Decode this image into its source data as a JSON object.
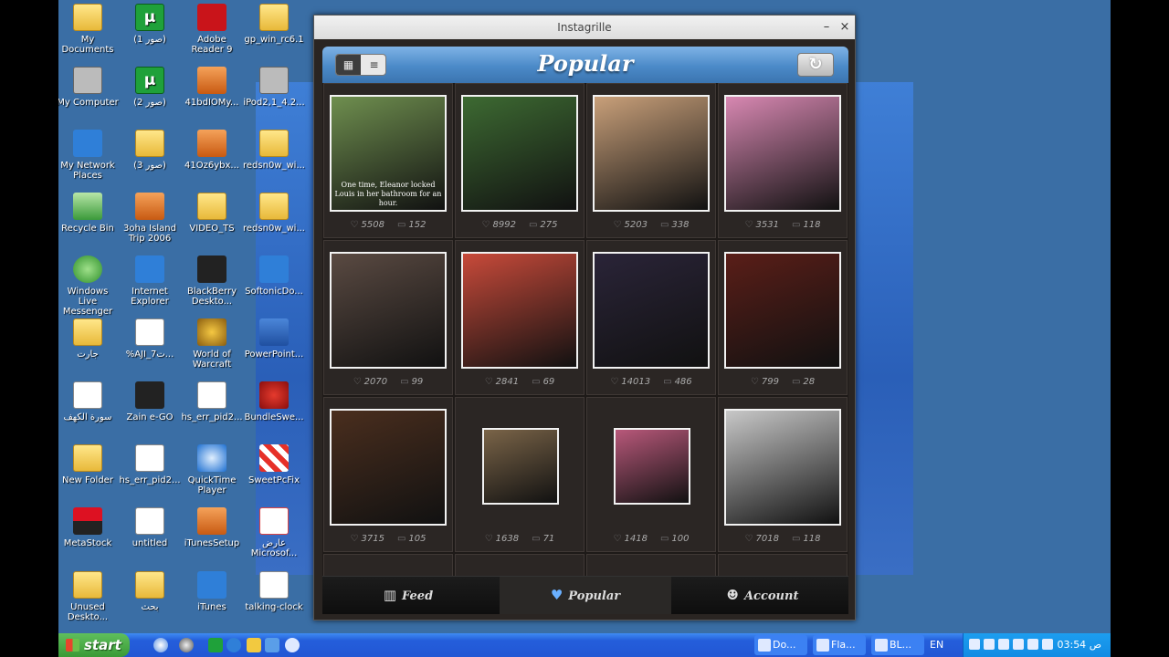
{
  "window": {
    "title": "Instagrille",
    "minimize_glyph": "–",
    "close_glyph": "×"
  },
  "header": {
    "title": "Popular",
    "grid_view_glyph": "▦",
    "list_view_glyph": "≡",
    "refresh_glyph": "↻"
  },
  "photos": [
    {
      "likes": "5508",
      "comments": "152",
      "color": "#6f8f4f"
    },
    {
      "likes": "8992",
      "comments": "275",
      "color": "#3d6a32"
    },
    {
      "likes": "5203",
      "comments": "338",
      "color": "#c9a07a"
    },
    {
      "likes": "3531",
      "comments": "118",
      "color": "#d888b2"
    },
    {
      "likes": "2070",
      "comments": "99",
      "color": "#5a4a42"
    },
    {
      "likes": "2841",
      "comments": "69",
      "color": "#c84a3a"
    },
    {
      "likes": "14013",
      "comments": "486",
      "color": "#2a2438"
    },
    {
      "likes": "799",
      "comments": "28",
      "color": "#5a1e18"
    },
    {
      "likes": "3715",
      "comments": "105",
      "color": "#4a2e1e"
    },
    {
      "likes": "1638",
      "comments": "71",
      "color": "#7a6448"
    },
    {
      "likes": "1418",
      "comments": "100",
      "color": "#b8587a"
    },
    {
      "likes": "7018",
      "comments": "118",
      "color": "#c8c8c8"
    }
  ],
  "photo_caption_1": "One time, Eleanor locked Louis in her bathroom for an hour.",
  "tabs": [
    {
      "label": "Feed",
      "icon": "▥"
    },
    {
      "label": "Popular",
      "icon": "♥"
    },
    {
      "label": "Account",
      "icon": "☻"
    }
  ],
  "desktop_icons": [
    {
      "label": "My Documents"
    },
    {
      "label": "(صور 1)"
    },
    {
      "label": "Adobe Reader 9"
    },
    {
      "label": "gp_win_rc6.1"
    },
    {
      "label": "My Computer"
    },
    {
      "label": "(صور 2)"
    },
    {
      "label": "41bdIOMy..."
    },
    {
      "label": "iPod2,1_4.2..."
    },
    {
      "label": "My Network Places"
    },
    {
      "label": "(صور 3)"
    },
    {
      "label": "41Oz6ybx..."
    },
    {
      "label": "redsn0w_wi..."
    },
    {
      "label": "Recycle Bin"
    },
    {
      "label": "3oha Island Trip 2006"
    },
    {
      "label": "VIDEO_TS"
    },
    {
      "label": "redsn0w_wi..."
    },
    {
      "label": "Windows Live Messenger"
    },
    {
      "label": "Internet Explorer"
    },
    {
      "label": "BlackBerry Deskto..."
    },
    {
      "label": "SoftonicDo..."
    },
    {
      "label": "جارت"
    },
    {
      "label": "%AJI_ت7..."
    },
    {
      "label": "World of Warcraft"
    },
    {
      "label": "PowerPoint..."
    },
    {
      "label": "سورة الكهف"
    },
    {
      "label": "Zain e-GO"
    },
    {
      "label": "hs_err_pid2..."
    },
    {
      "label": "BundleSwe..."
    },
    {
      "label": "New Folder"
    },
    {
      "label": "hs_err_pid2..."
    },
    {
      "label": "QuickTime Player"
    },
    {
      "label": "SweetPcFix"
    },
    {
      "label": "MetaStock"
    },
    {
      "label": "untitled"
    },
    {
      "label": "iTunesSetup"
    },
    {
      "label": "عارض Microsof..."
    },
    {
      "label": "Unused Deskto..."
    },
    {
      "label": "بحث"
    },
    {
      "label": "iTunes"
    },
    {
      "label": "talking-clock"
    }
  ],
  "taskbar": {
    "start_label": "start",
    "buttons": [
      {
        "label": "Do..."
      },
      {
        "label": "Fla..."
      },
      {
        "label": "BL..."
      }
    ],
    "language": "EN",
    "clock": "03:54 ص"
  }
}
